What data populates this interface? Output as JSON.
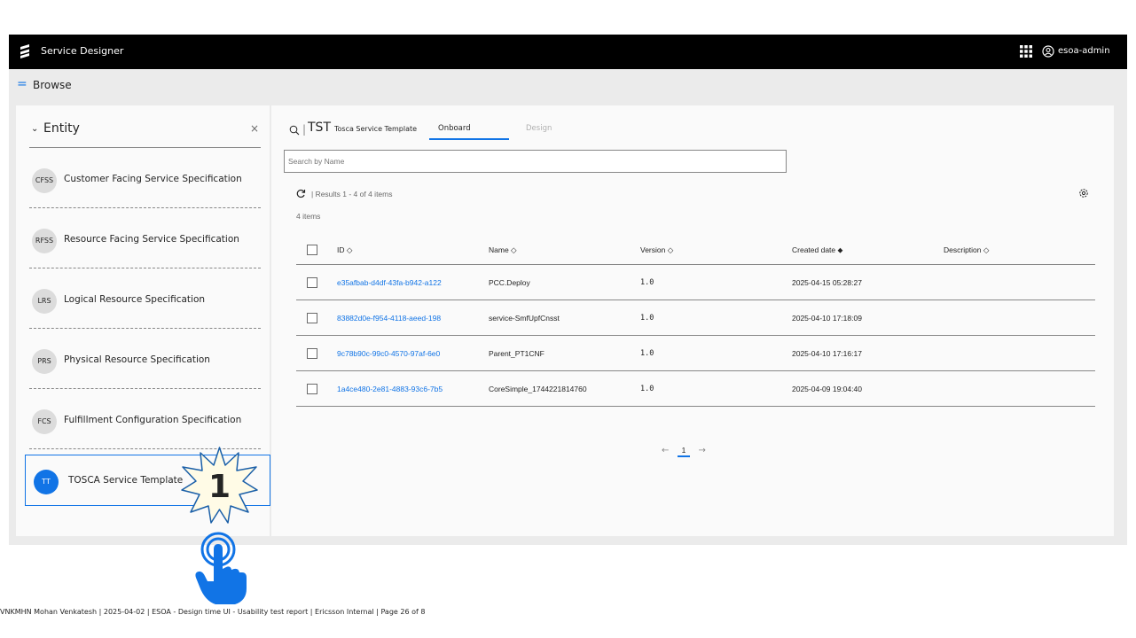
{
  "topbar": {
    "app_title": "Service Designer",
    "user_name": "esoa-admin"
  },
  "browse": {
    "menu_glyph": "=",
    "title": "Browse"
  },
  "left_panel": {
    "title": "Entity",
    "close_glyph": "×",
    "chevron_glyph": "⌄",
    "items": [
      {
        "badge": "CFSS",
        "label": "Customer Facing Service Specification"
      },
      {
        "badge": "RFSS",
        "label": "Resource Facing Service Specification"
      },
      {
        "badge": "LRS",
        "label": "Logical Resource Specification"
      },
      {
        "badge": "PRS",
        "label": "Physical Resource Specification"
      },
      {
        "badge": "FCS",
        "label": "Fulfillment Configuration Specification"
      },
      {
        "badge": "TT",
        "label": "TOSCA Service Template"
      }
    ]
  },
  "main": {
    "divider": "|",
    "entity_code": "TST",
    "entity_name": "Tosca Service Template",
    "tabs": [
      {
        "label": "Onboard",
        "active": true
      },
      {
        "label": "Design",
        "active": false
      }
    ],
    "search_placeholder": "Search by Name",
    "results_text": "|   Results 1 - 4 of 4 items",
    "items_count": "4 items",
    "columns": [
      "ID ◇",
      "Name ◇",
      "Version ◇",
      "Created date ⬥",
      "Description ◇"
    ],
    "rows": [
      {
        "id": "e35afbab-d4df-43fa-b942-a122",
        "name": "PCC.Deploy",
        "version": "1.0",
        "created": "2025-04-15 05:28:27",
        "description": ""
      },
      {
        "id": "83882d0e-f954-4118-aeed-198",
        "name": "service-SmfUpfCnsst",
        "version": "1.0",
        "created": "2025-04-10 17:18:09",
        "description": ""
      },
      {
        "id": "9c78b90c-99c0-4570-97af-6e0",
        "name": "Parent_PT1CNF",
        "version": "1.0",
        "created": "2025-04-10 17:16:17",
        "description": ""
      },
      {
        "id": "1a4ce480-2e81-4883-93c6-7b5",
        "name": "CoreSimple_1744221814760",
        "version": "1.0",
        "created": "2025-04-09 19:04:40",
        "description": ""
      }
    ],
    "pagination": {
      "prev": "←",
      "page": "1",
      "next": "→"
    }
  },
  "annotation": {
    "step_number": "1"
  },
  "footer": {
    "text": "VNKMHN Mohan Venkatesh  |  2025-04-02  |  ESOA - Design time UI - Usability test report  |  Ericsson Internal  |  Page 26 of 8"
  },
  "colors": {
    "accent": "#1174e6",
    "topbar": "#000000",
    "panel_bg": "#fafafa",
    "frame_bg": "#ebebeb"
  }
}
